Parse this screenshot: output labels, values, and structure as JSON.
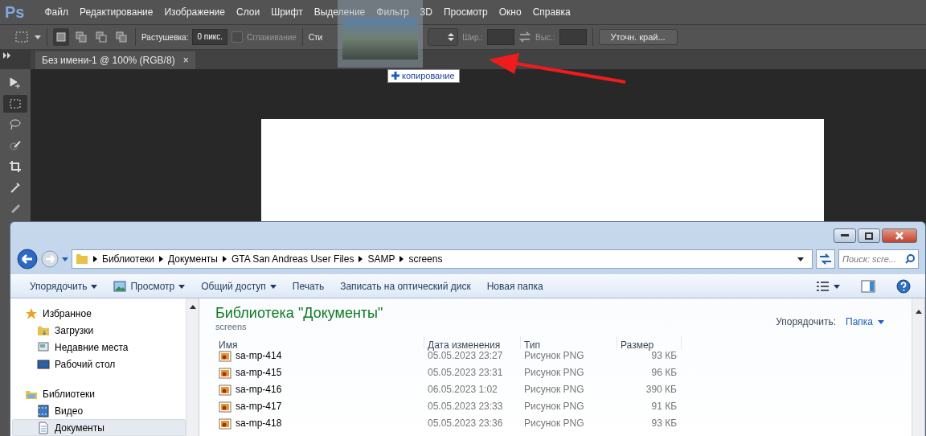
{
  "photoshop": {
    "logo": "Ps",
    "menu": [
      "Файл",
      "Редактирование",
      "Изображение",
      "Слои",
      "Шрифт",
      "Выделение",
      "Фильтр",
      "3D",
      "Просмотр",
      "Окно",
      "Справка"
    ],
    "selection_modes": [
      {
        "selected": true
      },
      {
        "selected": false
      },
      {
        "selected": false
      },
      {
        "selected": false
      }
    ],
    "feather_label": "Растушевка:",
    "feather_value": "0 пикс.",
    "antialias": {
      "label": "Сглаживание",
      "checked": false
    },
    "style_label": "Сти",
    "width_label": "Шир.:",
    "height_label": "Выс.:",
    "refine_button": "Уточн. край...",
    "doc_tab": {
      "title": "Без имени-1 @ 100% (RGB/8)",
      "close": "×"
    },
    "tools": [
      {
        "selected": false
      },
      {
        "selected": true
      },
      {
        "selected": false
      },
      {
        "selected": false
      },
      {
        "selected": false
      },
      {
        "selected": false
      },
      {
        "selected": false
      }
    ],
    "drag_badge": "копирование"
  },
  "explorer": {
    "breadcrumbs": [
      "Библиотеки",
      "Документы",
      "GTA San Andreas User Files",
      "SAMP",
      "screens"
    ],
    "search": {
      "placeholder": "Поиск: scre..."
    },
    "commands": [
      {
        "label": "Упорядочить",
        "dropdown": true
      },
      {
        "label": "Просмотр",
        "dropdown": true
      },
      {
        "label": "Общий доступ",
        "dropdown": true
      },
      {
        "label": "Печать",
        "dropdown": false
      },
      {
        "label": "Записать на оптический диск",
        "dropdown": false
      },
      {
        "label": "Новая папка",
        "dropdown": false
      }
    ],
    "nav": [
      {
        "label": "Избранное",
        "items": [
          {
            "label": "Загрузки",
            "selected": false
          },
          {
            "label": "Недавние места",
            "selected": false
          },
          {
            "label": "Рабочий стол",
            "selected": false
          }
        ]
      },
      {
        "label": "Библиотеки",
        "items": [
          {
            "label": "Видео",
            "selected": false
          },
          {
            "label": "Документы",
            "selected": true
          }
        ]
      }
    ],
    "title": "Библиотека \"Документы\"",
    "subtitle": "screens",
    "arrange_label": "Упорядочить:",
    "arrange_value": "Папка",
    "columns": [
      "Имя",
      "Дата изменения",
      "Тип",
      "Размер"
    ],
    "rows": [
      [
        "sa-mp-414",
        "05.05.2023 23:27",
        "Рисунок PNG",
        "93 КБ"
      ],
      [
        "sa-mp-415",
        "05.05.2023 23:31",
        "Рисунок PNG",
        "96 КБ"
      ],
      [
        "sa-mp-416",
        "06.05.2023 1:02",
        "Рисунок PNG",
        "390 КБ"
      ],
      [
        "sa-mp-417",
        "05.05.2023 23:33",
        "Рисунок PNG",
        "91 КБ"
      ],
      [
        "sa-mp-418",
        "05.05.2023 23:36",
        "Рисунок PNG",
        "93 КБ"
      ]
    ]
  }
}
